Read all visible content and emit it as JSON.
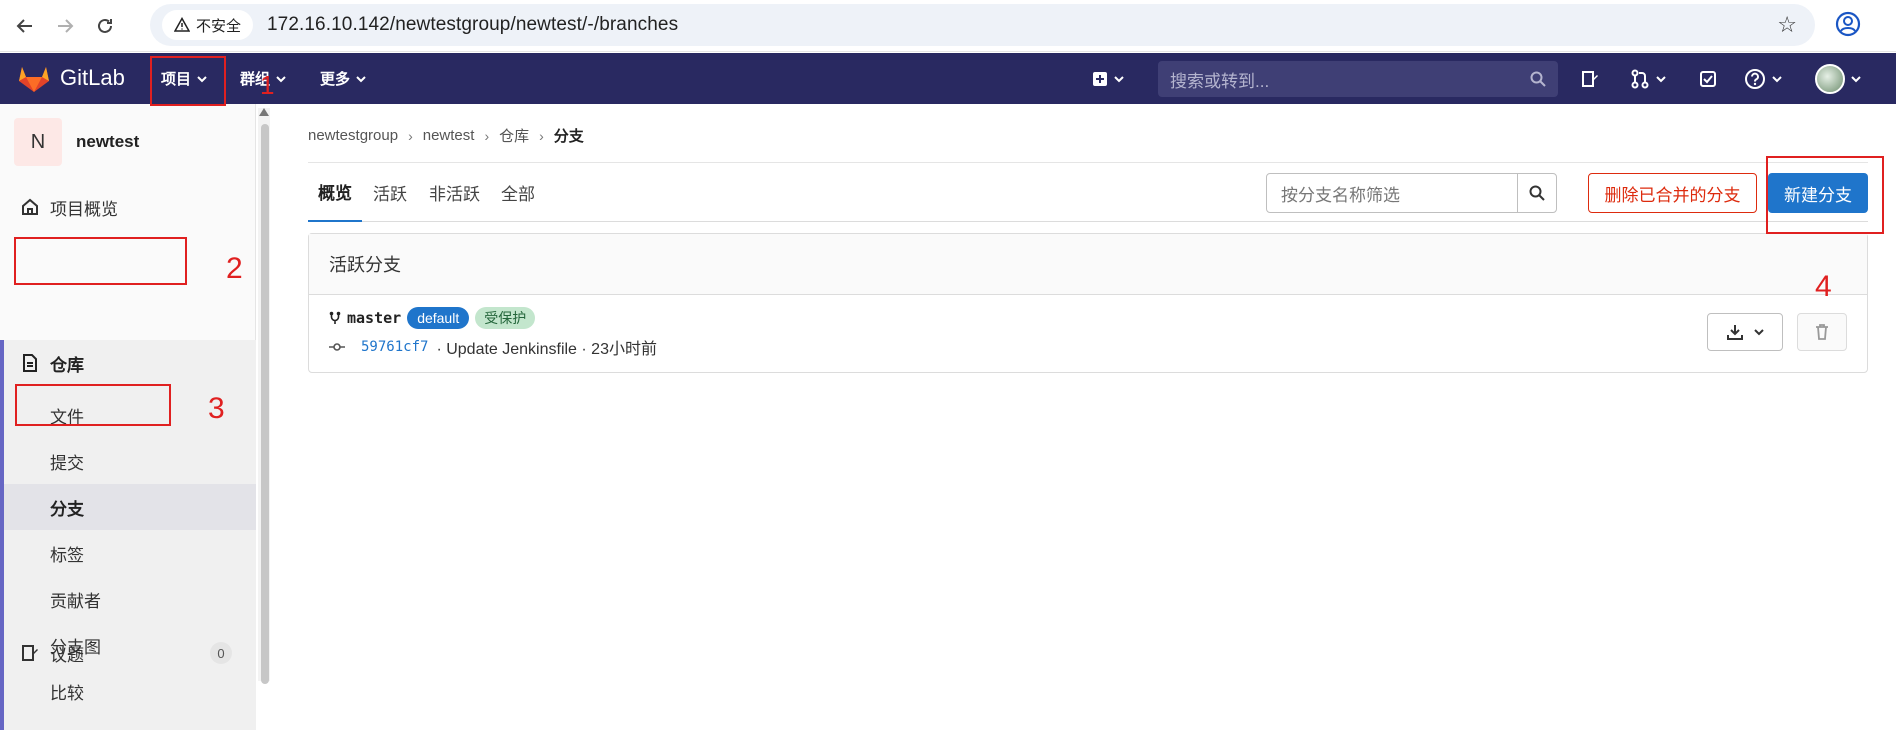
{
  "browser": {
    "insecure_label": "不安全",
    "url": "172.16.10.142/newtestgroup/newtest/-/branches"
  },
  "topnav": {
    "logo_text": "GitLab",
    "menu": [
      "项目",
      "群组",
      "更多"
    ],
    "search_placeholder": "搜索或转到..."
  },
  "sidebar": {
    "project_initial": "N",
    "project_name": "newtest",
    "overview": "项目概览",
    "repository": "仓库",
    "sub_items": [
      "文件",
      "提交",
      "分支",
      "标签",
      "贡献者",
      "分支图",
      "比较"
    ],
    "issues": "议题",
    "issues_count": "0"
  },
  "breadcrumb": [
    "newtestgroup",
    "newtest",
    "仓库",
    "分支"
  ],
  "tabs": [
    "概览",
    "活跃",
    "非活跃",
    "全部"
  ],
  "filter_placeholder": "按分支名称筛选",
  "buttons": {
    "delete_merged": "删除已合并的分支",
    "new_branch": "新建分支"
  },
  "panel": {
    "title": "活跃分支",
    "branch": {
      "name": "master",
      "badge_default": "default",
      "badge_protected": "受保护",
      "commit_sha": "59761cf7",
      "commit_text": "· Update Jenkinsfile · 23小时前"
    }
  },
  "annotations": [
    "1",
    "2",
    "3",
    "4"
  ],
  "colors": {
    "nav_bg": "#292961",
    "primary": "#1f75cb",
    "danger": "#dd2b0e",
    "annotation": "#e02020"
  }
}
